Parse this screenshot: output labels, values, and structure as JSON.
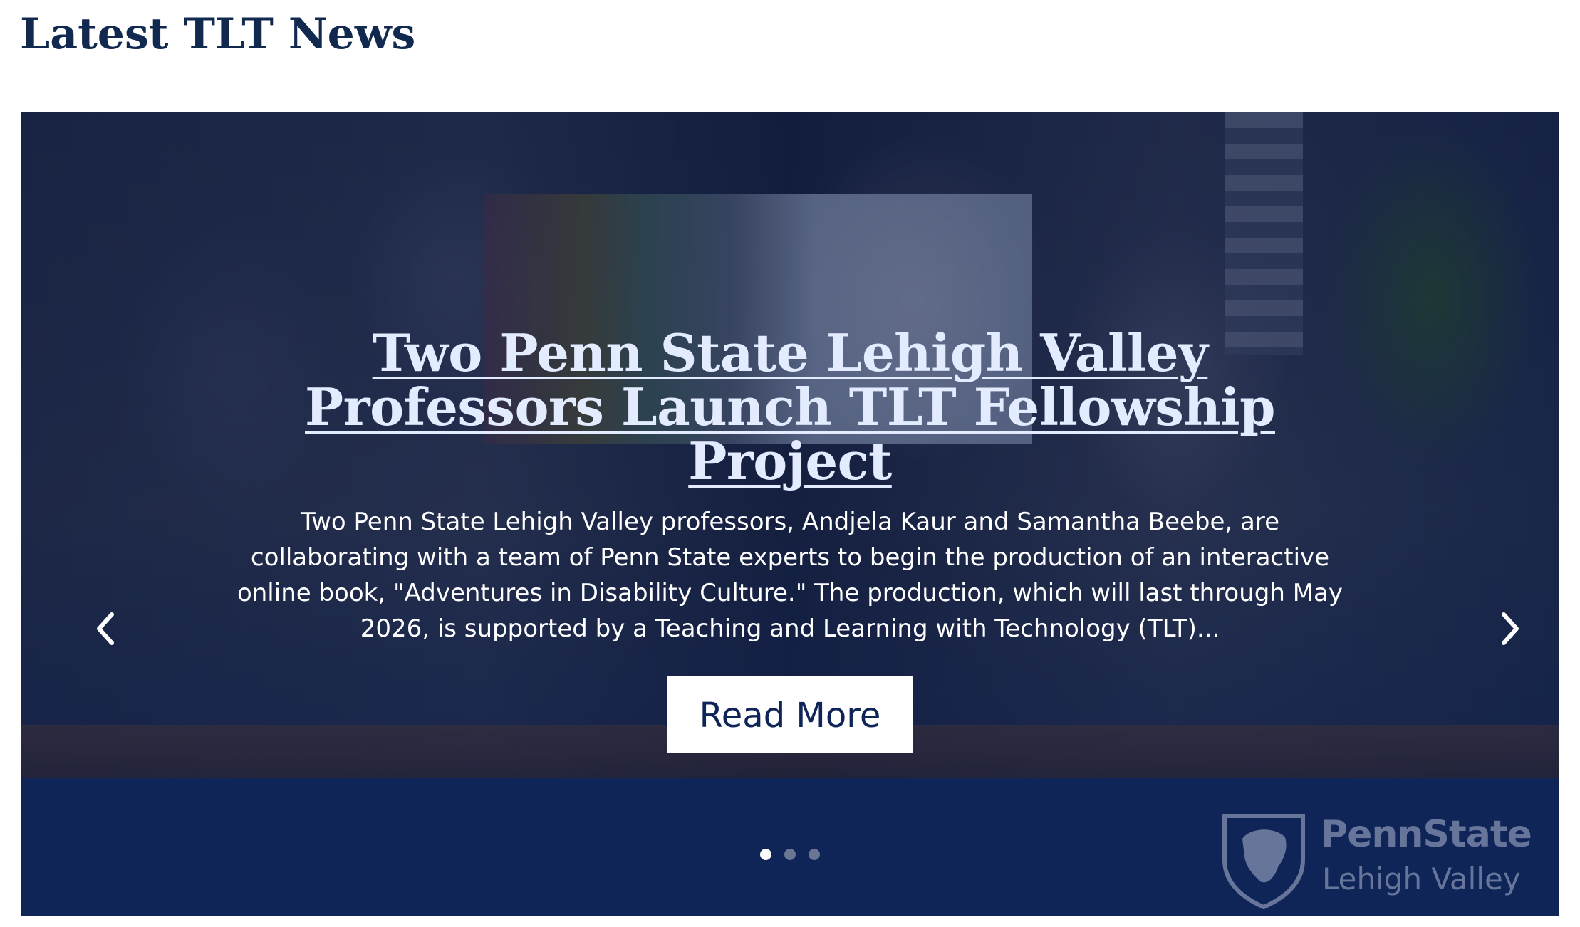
{
  "section": {
    "title": "Latest TLT News"
  },
  "carousel": {
    "slide": {
      "title": "Two Penn State Lehigh Valley Professors Launch TLT Fellowship Project",
      "excerpt": "Two Penn State Lehigh Valley professors, Andjela Kaur and Samantha Beebe, are collaborating with a team of Penn State experts to begin the production of an interactive online book, \"Adventures in Disability Culture.\" The production, which will last through May 2026, is supported by a Teaching and Learning with Technology (TLT)...",
      "button_label": "Read More"
    },
    "prev_icon": "chevron-left-icon",
    "next_icon": "chevron-right-icon",
    "slide_count": 3,
    "active_index": 0,
    "logo": {
      "brand": "PennState",
      "campus": "Lehigh Valley"
    }
  },
  "colors": {
    "title_text": "#11294f",
    "carousel_bg": "#0f2457",
    "slide_title": "#e3ecff",
    "button_bg": "#ffffff"
  }
}
